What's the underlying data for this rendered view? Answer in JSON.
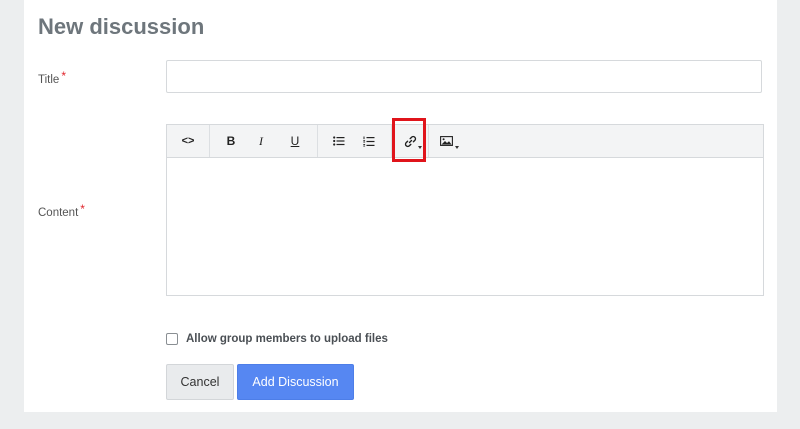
{
  "page": {
    "title": "New discussion"
  },
  "form": {
    "title_label": "Title",
    "title_value": "",
    "title_placeholder": "",
    "required_mark": "*",
    "content_label": "Content",
    "content_value": ""
  },
  "toolbar": {
    "code": "<>",
    "bold": "B",
    "italic": "I",
    "underline": "U",
    "icons": [
      "code-view-icon",
      "bold-icon",
      "italic-icon",
      "underline-icon",
      "bullet-list-icon",
      "numbered-list-icon",
      "link-icon",
      "image-icon"
    ]
  },
  "options": {
    "upload_label": "Allow group members to upload files",
    "upload_checked": false
  },
  "actions": {
    "cancel_label": "Cancel",
    "add_label": "Add Discussion"
  },
  "colors": {
    "primary": "#5687f2",
    "required": "#e0252c",
    "highlight": "#e0141b",
    "title": "#6e767c"
  }
}
